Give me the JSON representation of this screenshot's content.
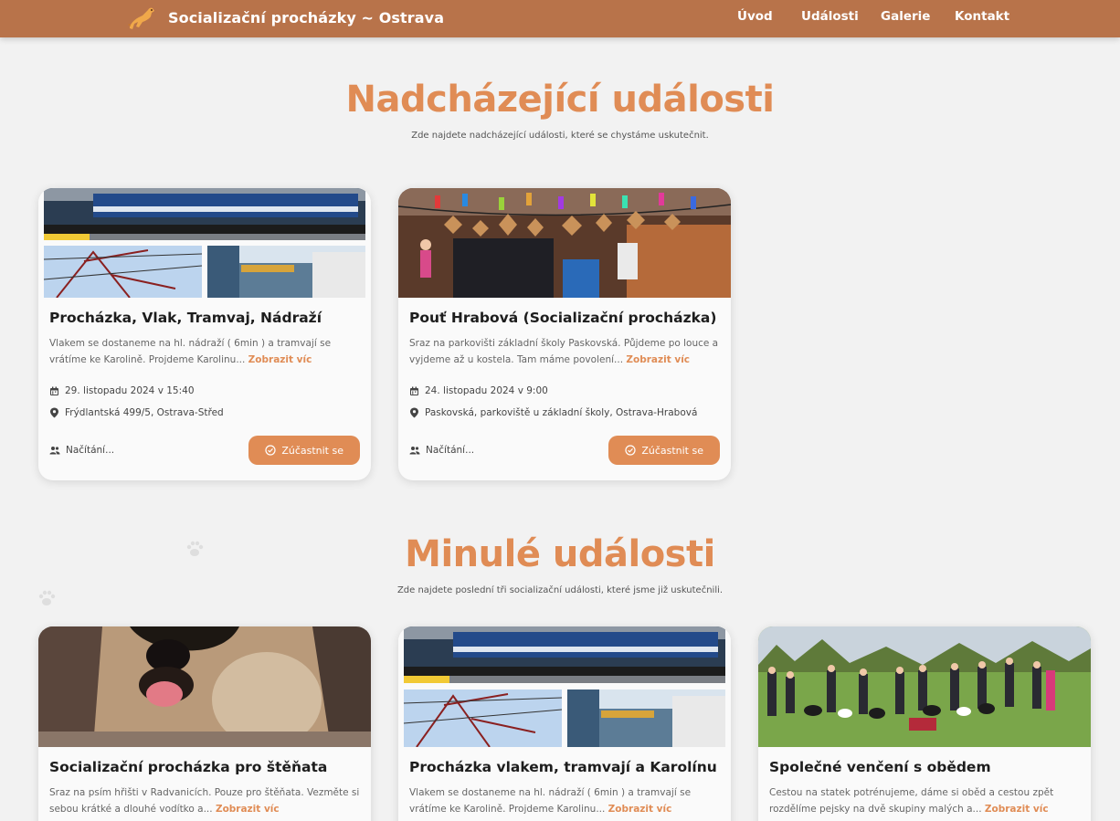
{
  "nav": {
    "brand": "Socializační procházky ~ Ostrava",
    "links": [
      "Úvod",
      "Události",
      "Galerie",
      "Kontakt"
    ]
  },
  "upcoming": {
    "title": "Nadcházející události",
    "subtitle": "Zde najdete nadcházející události, které se chystáme uskutečnit.",
    "cards": [
      {
        "title": "Procházka, Vlak, Tramvaj, Nádraží",
        "desc": "Vlakem se dostaneme na hl. nádraží ( 6min ) a tramvají se vrátíme ke Karolině. Projdeme Karolinu...",
        "more": "Zobrazit víc",
        "date": "29. listopadu 2024 v 15:40",
        "location": "Frýdlantská 499/5, Ostrava-Střed",
        "attendees": "Načítání...",
        "button": "Zúčastnit se"
      },
      {
        "title": "Pouť Hrabová (Socializační procházka)",
        "desc": "Sraz na parkovišti základní školy Paskovská. Půjdeme po louce a vyjdeme až u kostela. Tam máme povolení...",
        "more": "Zobrazit víc",
        "date": "24. listopadu 2024 v 9:00",
        "location": "Paskovská, parkoviště u základní školy, Ostrava-Hrabová",
        "attendees": "Načítání...",
        "button": "Zúčastnit se"
      }
    ]
  },
  "past": {
    "title": "Minulé události",
    "subtitle": "Zde najdete poslední tři socializační události, které jsme již uskutečnili.",
    "cards": [
      {
        "title": "Socializační procházka pro štěňata",
        "desc": "Sraz na psím hřišti v Radvanicích. Pouze pro štěňata. Vezměte si sebou krátké a dlouhé vodítko a...",
        "more": "Zobrazit víc"
      },
      {
        "title": "Procházka vlakem, tramvají a Karolínu",
        "desc": "Vlakem se dostaneme na hl. nádraží ( 6min ) a tramvají se vrátíme ke Karolině. Projdeme Karolinu...",
        "more": "Zobrazit víc"
      },
      {
        "title": "Společné venčení s obědem",
        "desc": "Cestou na statek potrénujeme, dáme si oběd a cestou zpět rozdělíme pejsky na dvě skupiny malých a...",
        "more": "Zobrazit víc"
      }
    ]
  },
  "colors": {
    "navbar": "#b8734a",
    "accent": "#e08c55",
    "background": "#f2f2f2",
    "card": "#fafafa"
  },
  "icons": [
    "dog-logo-icon",
    "calendar-icon",
    "map-pin-icon",
    "users-icon",
    "check-circle-icon",
    "paw-icon"
  ]
}
